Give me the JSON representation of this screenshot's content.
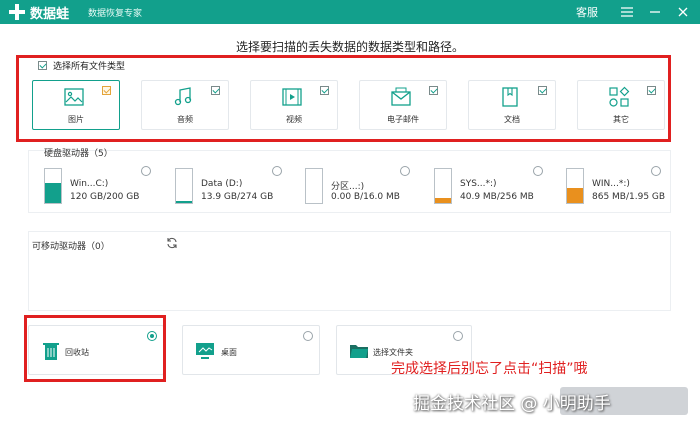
{
  "titlebar": {
    "app_name": "数据蛙",
    "subtitle": "数据恢复专家",
    "service_label": "客服",
    "brand_color": "#12a08c"
  },
  "prompt": "选择要扫描的丢失数据的数据类型和路径。",
  "file_types": {
    "select_all_label": "选择所有文件类型",
    "select_all_checked": true,
    "items": [
      {
        "label": "图片",
        "icon": "image-icon",
        "checked": true,
        "active": true
      },
      {
        "label": "音频",
        "icon": "music-icon",
        "checked": true,
        "active": false
      },
      {
        "label": "视频",
        "icon": "video-icon",
        "checked": true,
        "active": false
      },
      {
        "label": "电子邮件",
        "icon": "mail-icon",
        "checked": true,
        "active": false
      },
      {
        "label": "文档",
        "icon": "document-icon",
        "checked": true,
        "active": false
      },
      {
        "label": "其它",
        "icon": "other-icon",
        "checked": true,
        "active": false
      }
    ]
  },
  "hard_drives": {
    "title": "硬盘驱动器（5）",
    "drives": [
      {
        "name": "Win...C:)",
        "size": "120 GB/200 GB",
        "used_fraction": 0.6,
        "color": "teal",
        "icon": "windows-drive-icon"
      },
      {
        "name": "Data (D:)",
        "size": "13.9 GB/274 GB",
        "used_fraction": 0.05,
        "color": "teal",
        "icon": "drive-icon"
      },
      {
        "name": "分区...:)",
        "size": "0.00  B/16.0 MB",
        "used_fraction": 0.0,
        "color": "teal",
        "icon": "drive-icon"
      },
      {
        "name": "SYS...*:)",
        "size": "40.9 MB/256 MB",
        "used_fraction": 0.16,
        "color": "orange",
        "icon": "drive-icon"
      },
      {
        "name": "WIN...*:)",
        "size": "865 MB/1.95 GB",
        "used_fraction": 0.44,
        "color": "orange",
        "icon": "drive-icon"
      }
    ]
  },
  "removable": {
    "title": "可移动驱动器（0）"
  },
  "locations": [
    {
      "label": "回收站",
      "icon": "recycle-bin-icon",
      "selected": true
    },
    {
      "label": "桌面",
      "icon": "desktop-icon",
      "selected": false
    },
    {
      "label": "选择文件夹",
      "icon": "folder-icon",
      "selected": false
    }
  ],
  "annotation": "完成选择后别忘了点击“扫描”哦",
  "watermark": "掘金技术社区 @ 小明助手"
}
